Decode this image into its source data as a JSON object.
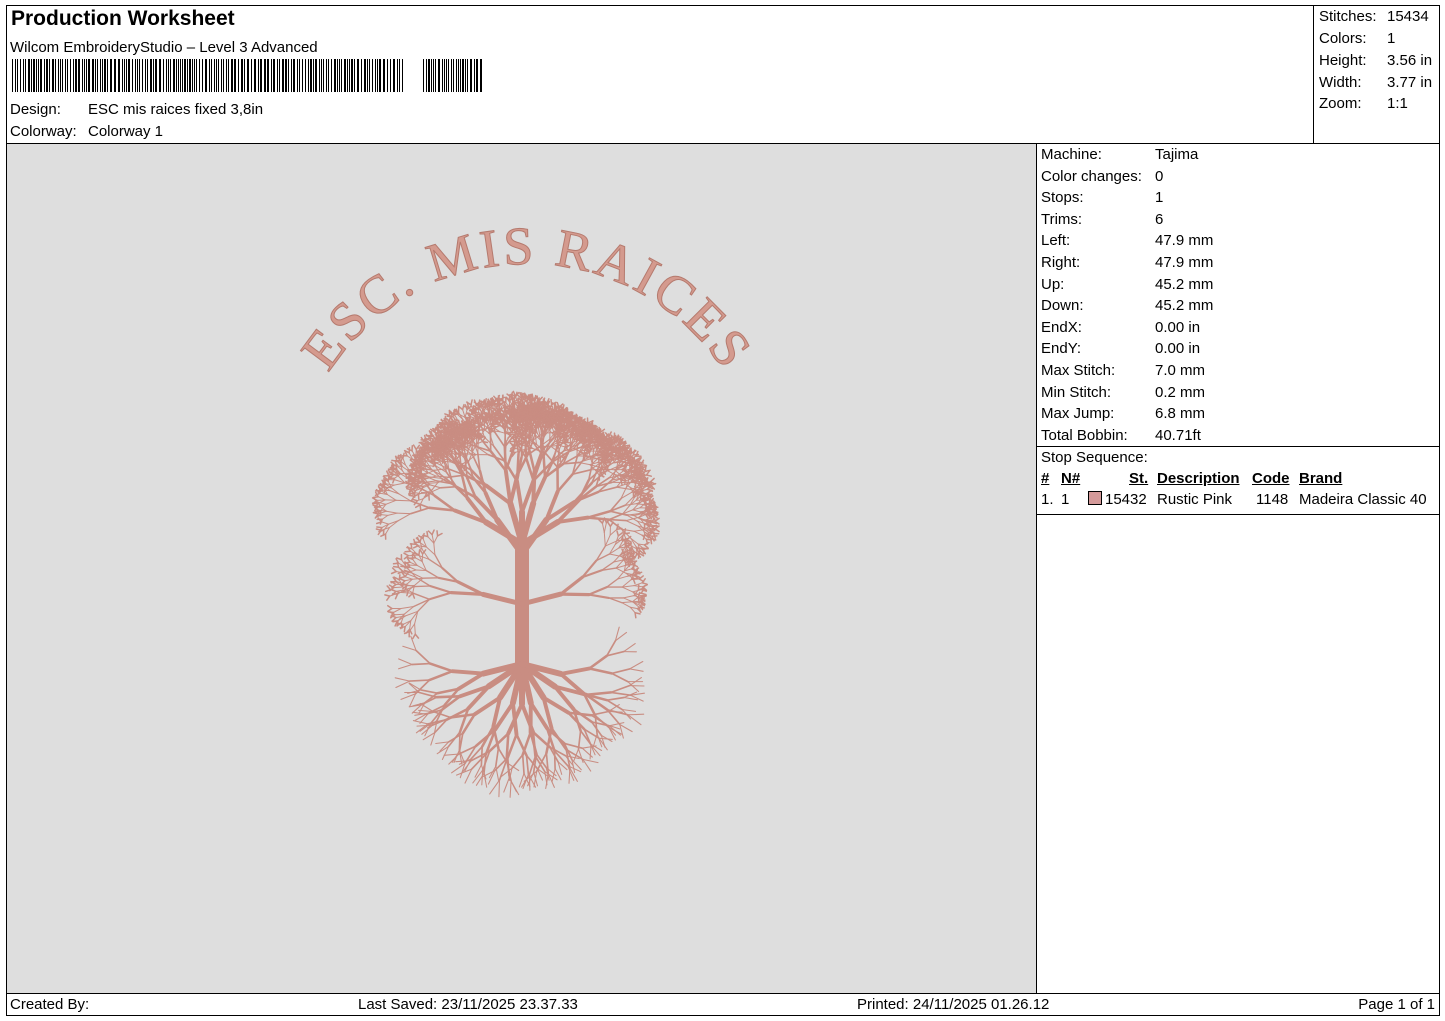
{
  "header": {
    "title": "Production Worksheet",
    "software": "Wilcom EmbroideryStudio – Level 3 Advanced",
    "design_label": "Design:",
    "design_value": "ESC mis raices fixed 3,8in",
    "colorway_label": "Colorway:",
    "colorway_value": "Colorway 1"
  },
  "stats": [
    {
      "label": "Stitches:",
      "value": "15434"
    },
    {
      "label": "Colors:",
      "value": "1"
    },
    {
      "label": "Height:",
      "value": "3.56 in"
    },
    {
      "label": "Width:",
      "value": "3.77 in"
    },
    {
      "label": "Zoom:",
      "value": "1:1"
    }
  ],
  "design_preview": {
    "text": "ESC. MIS RAICES",
    "thread_color": "#d49a8e",
    "background": "#dedede"
  },
  "machine_info": [
    {
      "label": "Machine:",
      "value": "Tajima"
    },
    {
      "label": "Color changes:",
      "value": "0"
    },
    {
      "label": "Stops:",
      "value": "1"
    },
    {
      "label": "Trims:",
      "value": "6"
    },
    {
      "label": "Left:",
      "value": "47.9 mm"
    },
    {
      "label": "Right:",
      "value": "47.9 mm"
    },
    {
      "label": "Up:",
      "value": "45.2 mm"
    },
    {
      "label": "Down:",
      "value": "45.2 mm"
    },
    {
      "label": "EndX:",
      "value": "0.00 in"
    },
    {
      "label": "EndY:",
      "value": "0.00 in"
    },
    {
      "label": "Max Stitch:",
      "value": "7.0 mm"
    },
    {
      "label": "Min Stitch:",
      "value": "0.2 mm"
    },
    {
      "label": "Max Jump:",
      "value": "6.8 mm"
    },
    {
      "label": "Total Bobbin:",
      "value": "40.71ft"
    }
  ],
  "stop_sequence": {
    "title": "Stop Sequence:",
    "columns": {
      "num": "#",
      "n": "N#",
      "st": "St.",
      "description": "Description",
      "code": "Code",
      "brand": "Brand"
    },
    "rows": [
      {
        "num": "1.",
        "n": "1",
        "st": "15432",
        "description": "Rustic Pink",
        "code": "1148",
        "brand": "Madeira Classic 40",
        "swatch": "#d49a9a"
      }
    ]
  },
  "footer": {
    "created_by": "Created By:",
    "last_saved": "Last Saved: 23/11/2025 23.37.33",
    "printed": "Printed: 24/11/2025 01.26.12",
    "page": "Page 1 of 1"
  }
}
